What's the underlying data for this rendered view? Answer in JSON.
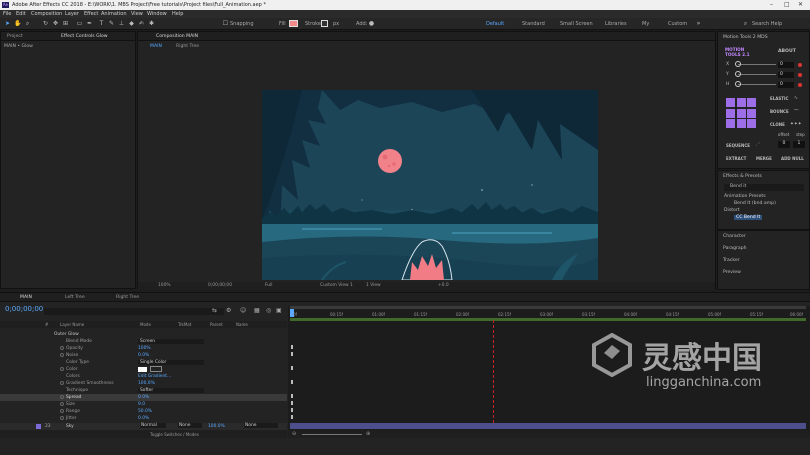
{
  "window": {
    "title": "Adobe After Effects CC 2018 - E:\\WORK\\1. MBS Project\\Free tutorials\\Project files\\Full_Animation.aep *"
  },
  "menu": [
    "File",
    "Edit",
    "Composition",
    "Layer",
    "Effect",
    "Animation",
    "View",
    "Window",
    "Help"
  ],
  "toolbar": {
    "snapping": "Snapping",
    "fill": "Fill",
    "stroke": "Stroke",
    "stroke_width": "px",
    "add": "Add:",
    "workspaces": [
      "Default",
      "Standard",
      "Small Screen",
      "Libraries",
      "My",
      "Custom"
    ],
    "search_placeholder": "Search Help"
  },
  "project_panel": {
    "tab_project": "Project",
    "tab_effect_controls": "Effect Controls Glow",
    "breadcrumb": "MAIN • Glow"
  },
  "composition_panel": {
    "tab": "Composition MAIN",
    "sub_tabs": [
      "MAIN",
      "Right Tree"
    ],
    "footer": {
      "zoom": "100%",
      "timecode": "0;00;00;00",
      "resolution": "Full",
      "view": "Custom View 1",
      "views": "1 View",
      "exposure": "+0.0"
    }
  },
  "motion_tools": {
    "title": "Motion Tools 2 MDS",
    "logo": "MOTION TOOLS 2.1",
    "about": "ABOUT",
    "rows": [
      {
        "label": "X",
        "value": "0"
      },
      {
        "label": "Y",
        "value": "0"
      },
      {
        "label": "H",
        "value": "0"
      }
    ],
    "elastic": "ELASTIC",
    "bounce": "BOUNCE",
    "clone": "CLONE",
    "offset": "offset",
    "step": "step",
    "sequence": "SEQUENCE",
    "seq_values": [
      "0",
      "1"
    ],
    "buttons": [
      "EXTRACT",
      "MERGE",
      "ADD NULL"
    ]
  },
  "effects_presets": {
    "title": "Effects & Presets",
    "search": "Bend it",
    "items": [
      "Animation Presets",
      "Bend It (bnd.amp)",
      "Distort",
      "CC Bend It"
    ]
  },
  "collapsed_panels": [
    "Character",
    "Paragraph",
    "Tracker",
    "Preview"
  ],
  "timeline": {
    "tabs": [
      "MAIN",
      "Left Tree",
      "Right Tree"
    ],
    "timecode": "0;00;00;00",
    "headers": {
      "num": "#",
      "layer": "Layer Name",
      "mode": "Mode",
      "trkmat": "TrkMat",
      "parent": "Parent",
      "name": "Name"
    },
    "rows": [
      {
        "name": "Outer Glow",
        "value": ""
      },
      {
        "name": "Blend Mode",
        "value": "Screen"
      },
      {
        "name": "Opacity",
        "value": "100%"
      },
      {
        "name": "Noise",
        "value": "0.0%"
      },
      {
        "name": "Color Type",
        "value": "Single Color"
      },
      {
        "name": "Color",
        "value": ""
      },
      {
        "name": "Colors",
        "value": "Edit Gradient..."
      },
      {
        "name": "Gradient Smoothness",
        "value": "100.0%"
      },
      {
        "name": "Technique",
        "value": "Softer"
      },
      {
        "name": "Spread",
        "value": "0.0%"
      },
      {
        "name": "Size",
        "value": "9.0"
      },
      {
        "name": "Range",
        "value": "50.0%"
      },
      {
        "name": "Jitter",
        "value": "0.0%"
      }
    ],
    "sky_row": {
      "num": "23",
      "name": "Sky",
      "mode": "Normal",
      "trkmat": "None",
      "pct": "100.0%",
      "parent": "None"
    },
    "footer": "Toggle Switches / Modes",
    "ruler": [
      "0f",
      "00:15f",
      "01:00f",
      "01:15f",
      "02:00f",
      "02:15f",
      "03:00f",
      "03:15f",
      "04:00f",
      "04:15f",
      "05:00f",
      "05:15f",
      "06:00f"
    ]
  },
  "watermark": {
    "cn": "灵感中国",
    "url": "lingganchina.com"
  }
}
